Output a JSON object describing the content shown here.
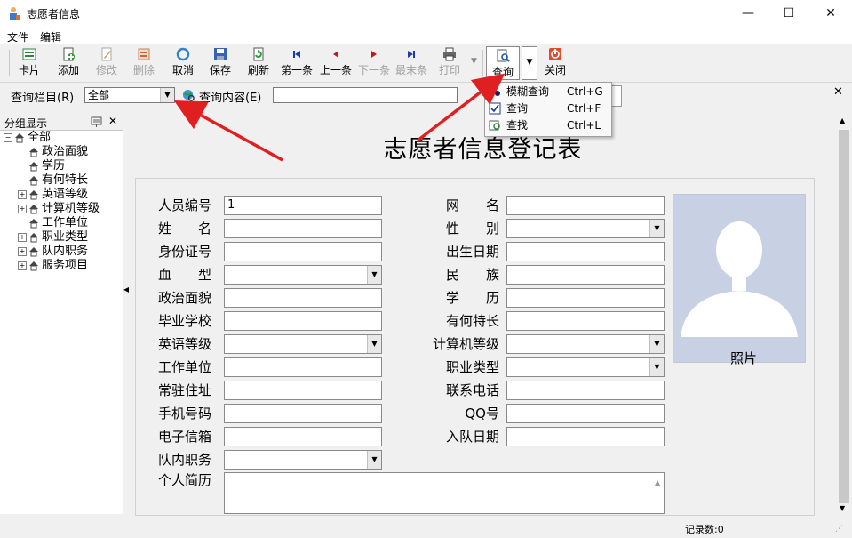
{
  "window": {
    "title": "志愿者信息",
    "minimize": "—",
    "maximize": "☐",
    "close": "✕"
  },
  "menubar": {
    "items": [
      "文件",
      "编辑"
    ]
  },
  "toolbar": {
    "buttons": [
      {
        "label": "卡片",
        "icon": "card-icon",
        "enabled": true
      },
      {
        "label": "添加",
        "icon": "add-icon",
        "enabled": true
      },
      {
        "label": "修改",
        "icon": "edit-icon",
        "enabled": false
      },
      {
        "label": "删除",
        "icon": "delete-icon",
        "enabled": false
      },
      {
        "label": "取消",
        "icon": "undo-icon",
        "enabled": true
      },
      {
        "label": "保存",
        "icon": "save-icon",
        "enabled": true
      },
      {
        "label": "刷新",
        "icon": "refresh-icon",
        "enabled": true
      },
      {
        "label": "第一条",
        "icon": "first-record-icon",
        "enabled": true
      },
      {
        "label": "上一条",
        "icon": "prev-record-icon",
        "enabled": true
      },
      {
        "label": "下一条",
        "icon": "next-record-icon",
        "enabled": false
      },
      {
        "label": "最末条",
        "icon": "last-record-icon",
        "enabled": false
      },
      {
        "label": "打印",
        "icon": "print-icon",
        "enabled": false
      },
      {
        "label": "查询",
        "icon": "query-icon",
        "enabled": true
      },
      {
        "label": "关闭",
        "icon": "close-power-icon",
        "enabled": true
      }
    ]
  },
  "querybar": {
    "column_label": "查询栏目(R)",
    "column_value": "全部",
    "content_label": "查询内容(E)",
    "content_value": ""
  },
  "popup_menu": {
    "items": [
      {
        "label": "模糊查询",
        "shortcut": "Ctrl+G",
        "icon": "binoculars-icon"
      },
      {
        "label": "查询",
        "shortcut": "Ctrl+F",
        "icon": "check-query-icon"
      },
      {
        "label": "查找",
        "shortcut": "Ctrl+L",
        "icon": "find-icon"
      }
    ]
  },
  "left_panel": {
    "title": "分组显示",
    "tree": [
      {
        "label": "全部",
        "level": 0,
        "expander": "−"
      },
      {
        "label": "政治面貌",
        "level": 1,
        "expander": ""
      },
      {
        "label": "学历",
        "level": 1,
        "expander": ""
      },
      {
        "label": "有何特长",
        "level": 1,
        "expander": ""
      },
      {
        "label": "英语等级",
        "level": 1,
        "expander": "+"
      },
      {
        "label": "计算机等级",
        "level": 1,
        "expander": "+"
      },
      {
        "label": "工作单位",
        "level": 1,
        "expander": ""
      },
      {
        "label": "职业类型",
        "level": 1,
        "expander": "+"
      },
      {
        "label": "队内职务",
        "level": 1,
        "expander": "+"
      },
      {
        "label": "服务项目",
        "level": 1,
        "expander": "+"
      }
    ]
  },
  "form": {
    "title": "志愿者信息登记表",
    "left_fields": [
      {
        "label": "人员编号",
        "value": "1",
        "dropdown": false
      },
      {
        "label": "姓　　名",
        "value": "",
        "dropdown": false
      },
      {
        "label": "身份证号",
        "value": "",
        "dropdown": false
      },
      {
        "label": "血　　型",
        "value": "",
        "dropdown": true
      },
      {
        "label": "政治面貌",
        "value": "",
        "dropdown": false
      },
      {
        "label": "毕业学校",
        "value": "",
        "dropdown": false
      },
      {
        "label": "英语等级",
        "value": "",
        "dropdown": true
      },
      {
        "label": "工作单位",
        "value": "",
        "dropdown": false
      },
      {
        "label": "常驻住址",
        "value": "",
        "dropdown": false
      },
      {
        "label": "手机号码",
        "value": "",
        "dropdown": false
      },
      {
        "label": "电子信箱",
        "value": "",
        "dropdown": false
      },
      {
        "label": "队内职务",
        "value": "",
        "dropdown": true
      }
    ],
    "right_fields": [
      {
        "label": "网　　名",
        "value": "",
        "dropdown": false
      },
      {
        "label": "性　　别",
        "value": "",
        "dropdown": true
      },
      {
        "label": "出生日期",
        "value": "",
        "dropdown": false
      },
      {
        "label": "民　　族",
        "value": "",
        "dropdown": false
      },
      {
        "label": "学　　历",
        "value": "",
        "dropdown": false
      },
      {
        "label": "有何特长",
        "value": "",
        "dropdown": false
      },
      {
        "label": "计算机等级",
        "value": "",
        "dropdown": true
      },
      {
        "label": "职业类型",
        "value": "",
        "dropdown": true
      },
      {
        "label": "联系电话",
        "value": "",
        "dropdown": false
      },
      {
        "label": "QQ号",
        "value": "",
        "dropdown": false
      },
      {
        "label": "入队日期",
        "value": "",
        "dropdown": false
      }
    ],
    "resume_label": "个人简历",
    "resume_value": "",
    "photo_label": "照片"
  },
  "statusbar": {
    "record_count": "记录数:0"
  },
  "colors": {
    "arrow": "#e02020",
    "photo_bg": "#c8d0e4",
    "photo_silhouette": "#ffffff"
  }
}
